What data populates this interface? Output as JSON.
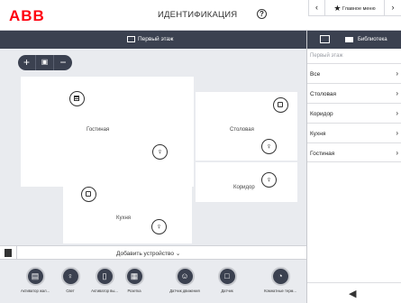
{
  "header": {
    "logo": "ABB",
    "title": "ИДЕНТИФИКАЦИЯ",
    "help_icon": "help-icon",
    "nav_prev": "‹",
    "nav_main_label": "Главное меню",
    "nav_next": "›"
  },
  "floorplan": {
    "floor_name": "Первый этаж",
    "zoom": {
      "plus": "+",
      "fit": "▣",
      "minus": "−"
    },
    "rooms": {
      "living": "Гостиная",
      "dining": "Столовая",
      "corridor": "Коридор",
      "kitchen": "Кухня"
    },
    "add_device_label": "Добавить устройство ⌄"
  },
  "device_types": [
    {
      "label": "Активатор жал...",
      "icon": "blind-actuator-icon"
    },
    {
      "label": "Свет",
      "icon": "light-icon"
    },
    {
      "label": "Активатор вы...",
      "icon": "switch-actuator-icon"
    },
    {
      "label": "Розетка",
      "icon": "socket-icon"
    },
    {
      "label": "Датчик движения",
      "icon": "motion-sensor-icon"
    },
    {
      "label": "Датчик",
      "icon": "sensor-icon"
    },
    {
      "label": "Комнатные терм...",
      "icon": "thermostat-icon"
    }
  ],
  "library": {
    "title": "Библиотека",
    "floor_label": "Первый этаж",
    "items": [
      "Все",
      "Столовая",
      "Коридор",
      "Кухня",
      "Гостиная"
    ],
    "back_icon": "back-arrow-icon"
  },
  "colors": {
    "brand": "#ff000f",
    "dark": "#3b4150",
    "canvas": "#e9ebef"
  }
}
